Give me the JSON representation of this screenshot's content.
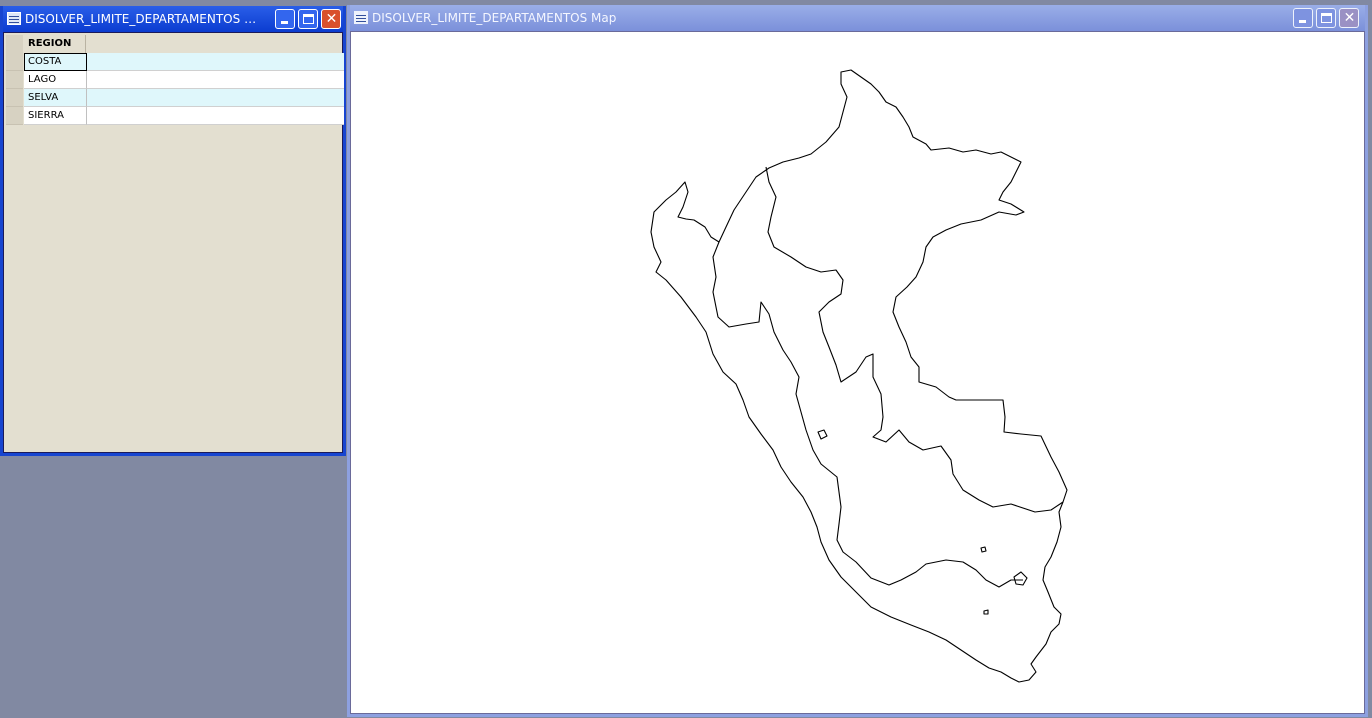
{
  "browser_window": {
    "title": "DISOLVER_LIMITE_DEPARTAMENTOS B...",
    "column_header": "REGION",
    "rows": [
      "COSTA",
      "LAGO",
      "SELVA",
      "SIERRA"
    ]
  },
  "map_window": {
    "title": "DISOLVER_LIMITE_DEPARTAMENTOS Map"
  },
  "titlebar_buttons": {
    "minimize": "_",
    "maximize": "□",
    "close": "✕"
  }
}
